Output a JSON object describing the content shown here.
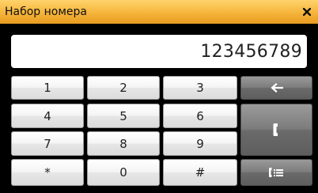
{
  "window": {
    "title": "Набор номера"
  },
  "display": {
    "value": "123456789"
  },
  "keypad": {
    "keys": [
      "1",
      "2",
      "3",
      "4",
      "5",
      "6",
      "7",
      "8",
      "9",
      "*",
      "0",
      "#"
    ]
  },
  "actions": {
    "backspace_icon": "left-arrow-icon",
    "call_icon": "phone-handset-icon",
    "contacts_icon": "phone-list-icon"
  },
  "colors": {
    "titlebar": "#f5b43a",
    "background": "#000000",
    "key_light": "#f0f0f0",
    "key_dark": "#7a7a7a"
  }
}
